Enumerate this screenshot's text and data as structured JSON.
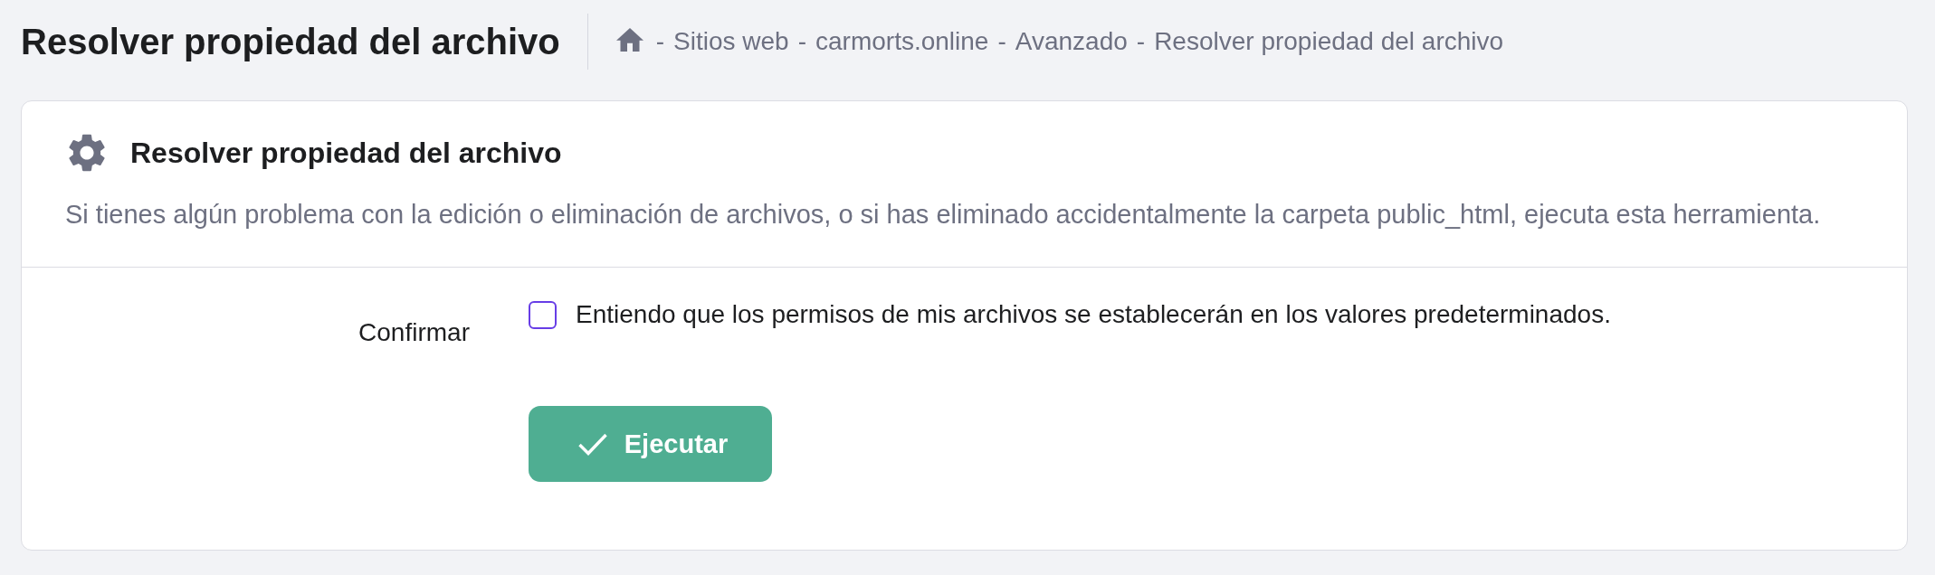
{
  "page_header": {
    "title": "Resolver propiedad del archivo",
    "breadcrumb": {
      "separator": "-",
      "items": [
        {
          "label": "Sitios web"
        },
        {
          "label": "carmorts.online"
        },
        {
          "label": "Avanzado"
        },
        {
          "label": "Resolver propiedad del archivo"
        }
      ]
    }
  },
  "card": {
    "title": "Resolver propiedad del archivo",
    "description": "Si tienes algún problema con la edición o eliminación de archivos, o si has eliminado accidentalmente la carpeta public_html, ejecuta esta herramienta.",
    "form": {
      "label": "Confirmar",
      "checkbox": {
        "label": "Entiendo que los permisos de mis archivos se establecerán en los valores predeterminados.",
        "checked": false
      },
      "submit_button": {
        "label": "Ejecutar"
      }
    }
  }
}
